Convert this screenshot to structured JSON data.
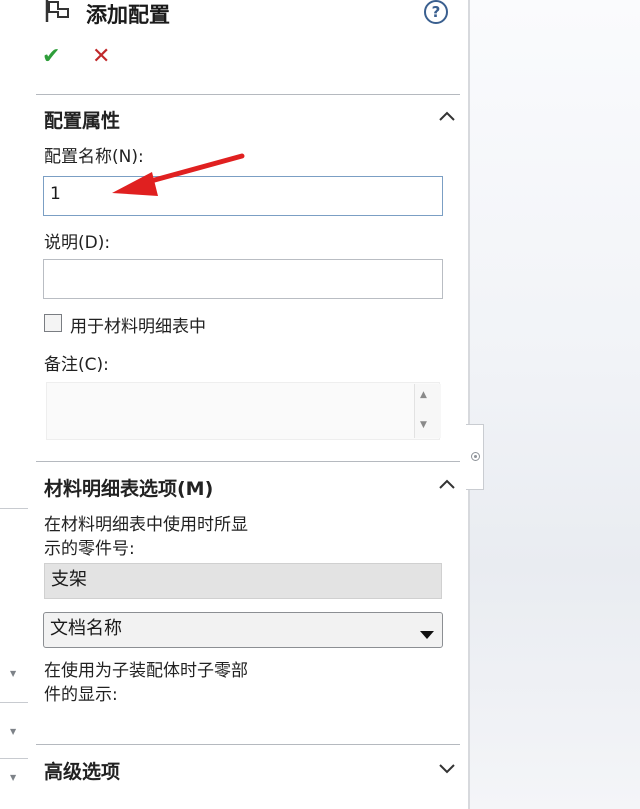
{
  "header": {
    "title": "添加配置",
    "help_symbol": "?"
  },
  "actions": {
    "ok_symbol": "✔",
    "cancel_symbol": "✕"
  },
  "config_properties": {
    "heading": "配置属性",
    "name_label": "配置名称(N):",
    "name_value": "1",
    "description_label": "说明(D):",
    "description_value": "",
    "bom_checkbox_label": "用于材料明细表中",
    "bom_checkbox_checked": false,
    "comment_label": "备注(C):",
    "comment_value": ""
  },
  "bom_options": {
    "heading": "材料明细表选项(M)",
    "part_number_label_line1": "在材料明细表中使用时所显",
    "part_number_label_line2": "示的零件号:",
    "part_number_value": "支架",
    "source_select_value": "文档名称",
    "child_display_label_line1": "在使用为子装配体时子零部",
    "child_display_label_line2": "件的显示:"
  },
  "advanced": {
    "heading": "高级选项"
  },
  "colors": {
    "ok": "#2e9e3a",
    "cancel": "#c0282a",
    "arrow": "#e02020",
    "help": "#3a5f8f"
  },
  "icons": {
    "header": "configuration-flag-icon",
    "help": "help-icon",
    "collapse": "chevron-up-icon",
    "expand": "chevron-down-icon",
    "annotation": "red-arrow-icon"
  }
}
